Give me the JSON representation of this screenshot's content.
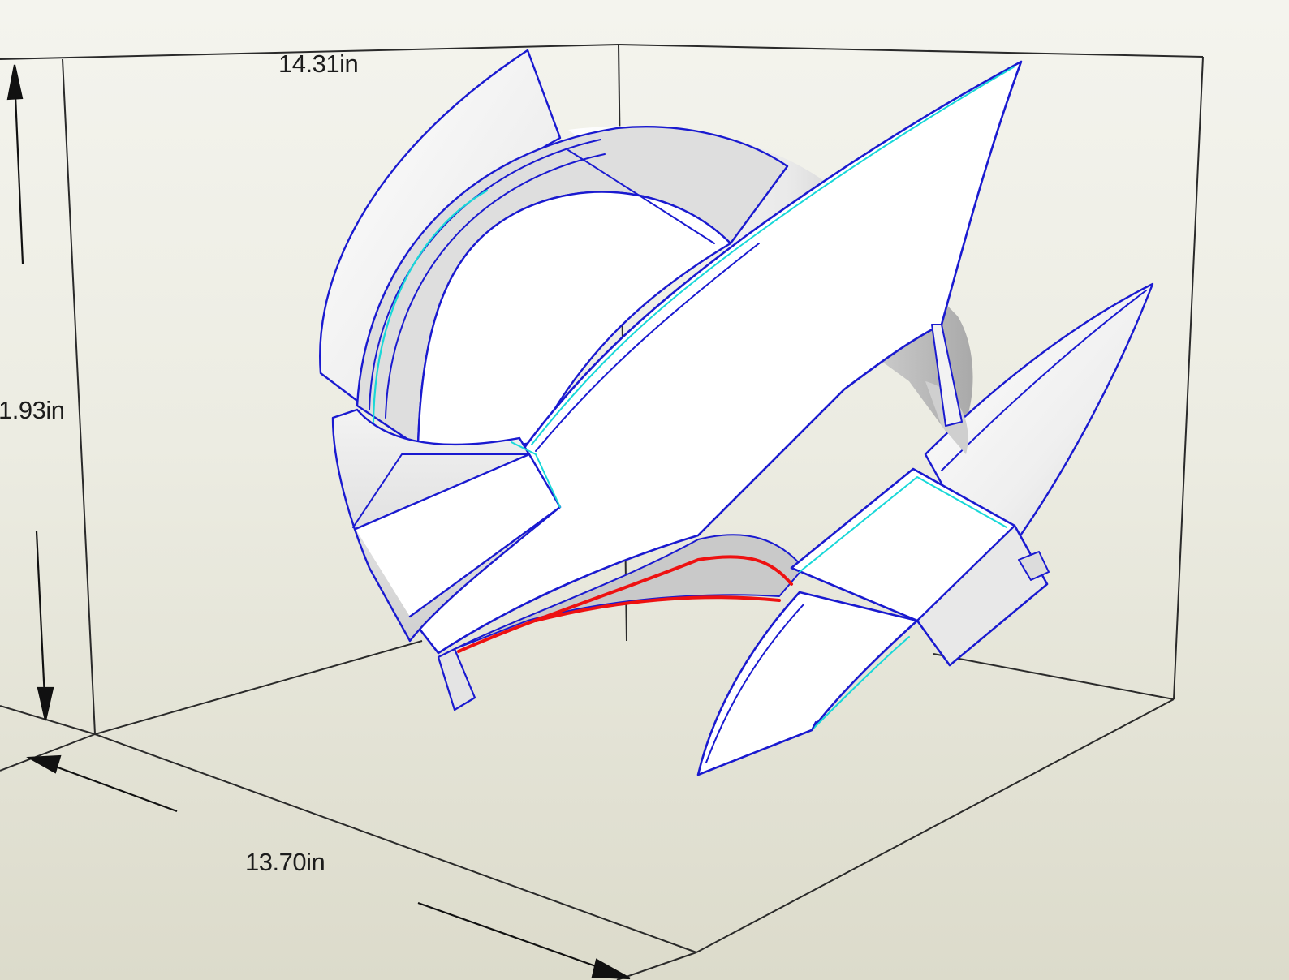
{
  "dimensions": {
    "width": "14.31in",
    "height": "1.93in",
    "depth": "13.70in"
  },
  "colors": {
    "background_top": "#f4f4ee",
    "background_bottom": "#dcdbcb",
    "bounding_box_lines": "#2a2a2a",
    "fold_edge_mountain": "#1c1ccf",
    "fold_edge_valley": "#18d8d8",
    "cut_edge": "#ee1111",
    "face_fill": "#ffffff",
    "face_shade": "#bdbdbd"
  },
  "model": {
    "name_icon": "helmet-3d-model-icon"
  }
}
